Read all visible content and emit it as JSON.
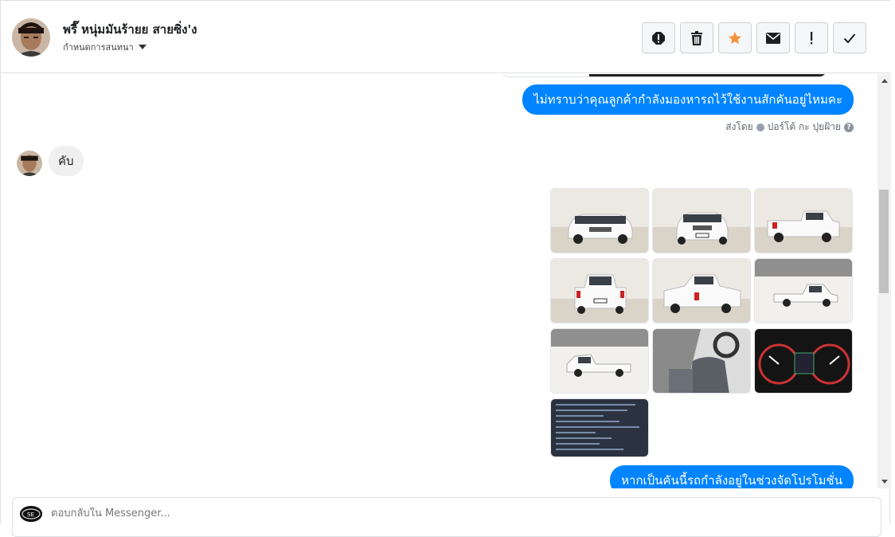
{
  "header": {
    "contact_name": "พรี๊ หนุ่มมันร้ายย สายซิ่ง'ง",
    "assign_label": "กำหนดการสนทนา",
    "actions": [
      {
        "name": "report-icon",
        "label": "report"
      },
      {
        "name": "trash-icon",
        "label": "delete"
      },
      {
        "name": "star-icon",
        "label": "star",
        "color": "#f7923b"
      },
      {
        "name": "envelope-icon",
        "label": "mark unread"
      },
      {
        "name": "exclamation-icon",
        "label": "important"
      },
      {
        "name": "check-icon",
        "label": "done"
      }
    ]
  },
  "messages": {
    "outgoing_1": "ไม่ทราบว่าคุณลูกค้ากำลังมองหารถไว้ใช้งานสักคันอยู่ไหมคะ",
    "sent_by_prefix": "ส่งโดย",
    "sent_by_name": "ปอร์โต้ กะ ปุยฝ้าย",
    "incoming_1": "คับ",
    "outgoing_2": "หากเป็นคันนี้รถกำลังอยู่ในช่วงจัดโปรโมชั่น",
    "photo_count": 10
  },
  "composer": {
    "placeholder": "ตอบกลับใน Messenger..."
  },
  "colors": {
    "outgoing_bubble": "#0084ff",
    "incoming_bubble": "#f1f0f0",
    "star": "#f7923b"
  }
}
